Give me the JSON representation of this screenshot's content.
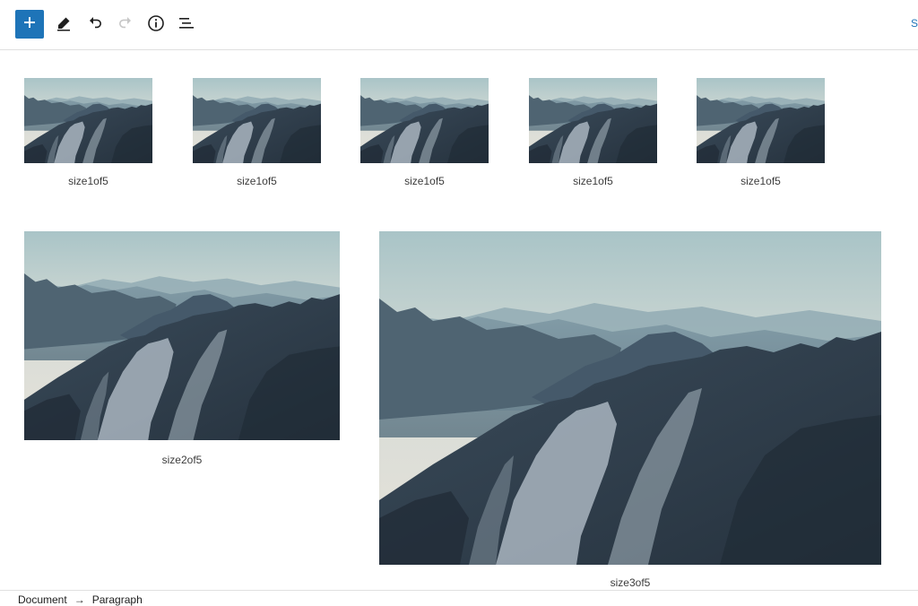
{
  "toolbar": {
    "add_icon": "plus-icon",
    "edit_icon": "pencil-icon",
    "undo_icon": "undo-icon",
    "redo_icon": "redo-icon",
    "info_icon": "info-icon",
    "outline_icon": "list-view-icon",
    "right_label": "S",
    "accent": "#1e74b8"
  },
  "gallery": {
    "row1": [
      {
        "caption": "size1of5"
      },
      {
        "caption": "size1of5"
      },
      {
        "caption": "size1of5"
      },
      {
        "caption": "size1of5"
      },
      {
        "caption": "size1of5"
      }
    ],
    "medium": {
      "caption": "size2of5"
    },
    "large": {
      "caption": "size3of5"
    }
  },
  "footer": {
    "crumbs": [
      "Document",
      "Paragraph"
    ],
    "separator": "→"
  }
}
